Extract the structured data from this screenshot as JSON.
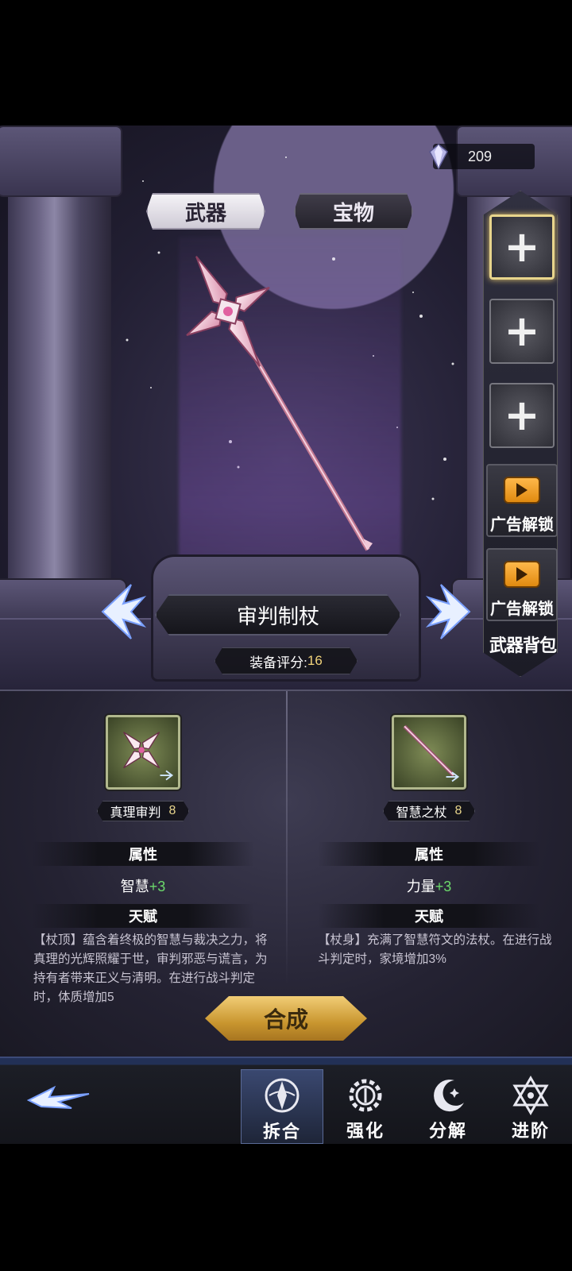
{
  "tabs": {
    "weapon": "武器",
    "treasure": "宝物"
  },
  "currency": {
    "icon": "crystal-gem-icon",
    "amount": "209"
  },
  "side_slots": {
    "add_icon": "+",
    "ad_unlock_label": "广告解锁",
    "bag_label": "武器背包"
  },
  "weapon": {
    "name": "审判制杖",
    "score_label": "装备评分:",
    "score_value": "16"
  },
  "parts": [
    {
      "name": "真理审判",
      "level": "8",
      "attr_title": "属性",
      "stat_name": "智慧",
      "stat_bonus": "+3",
      "talent_title": "天赋",
      "desc": "【杖顶】蕴含着终极的智慧与裁决之力，将真理的光辉照耀于世，审判邪恶与谎言，为持有者带来正义与清明。在进行战斗判定时，体质增加5"
    },
    {
      "name": "智慧之杖",
      "level": "8",
      "attr_title": "属性",
      "stat_name": "力量",
      "stat_bonus": "+3",
      "talent_title": "天赋",
      "desc": "【杖身】充满了智慧符文的法杖。在进行战斗判定时，家境增加3%"
    }
  ],
  "craft_button": "合成",
  "nav": [
    {
      "label": "拆合",
      "icon": "dismantle-merge-icon",
      "active": true
    },
    {
      "label": "强化",
      "icon": "gear-strengthen-icon",
      "active": false
    },
    {
      "label": "分解",
      "icon": "moon-decompose-icon",
      "active": false
    },
    {
      "label": "进阶",
      "icon": "hexagram-advance-icon",
      "active": false
    }
  ],
  "colors": {
    "accent_gold": "#e8d58c",
    "stat_green": "#6cd96c",
    "ad_orange": "#f0a030"
  }
}
